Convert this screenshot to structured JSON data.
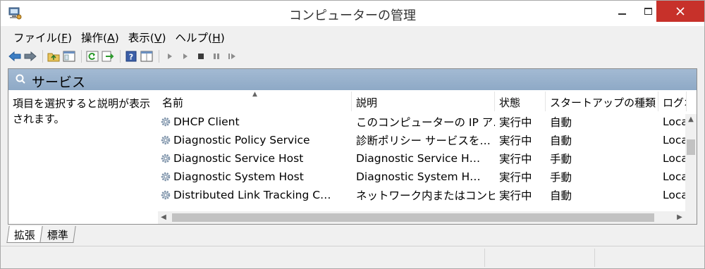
{
  "window": {
    "title": "コンピューターの管理"
  },
  "menu": [
    {
      "label": "ファイル(",
      "key": "F",
      "end": ")"
    },
    {
      "label": "操作(",
      "key": "A",
      "end": ")"
    },
    {
      "label": "表示(",
      "key": "V",
      "end": ")"
    },
    {
      "label": "ヘルプ(",
      "key": "H",
      "end": ")"
    }
  ],
  "toolbar": {
    "icons": [
      "back-icon",
      "forward-icon",
      "up-folder-icon",
      "show-hide-tree-icon",
      "refresh-icon",
      "export-list-icon",
      "help-icon",
      "properties-view-icon",
      "start-service-icon",
      "start-service-alt-icon",
      "stop-service-icon",
      "pause-service-icon",
      "resume-service-icon"
    ]
  },
  "panel": {
    "title": "サービス",
    "description_line1": "項目を選択すると説明が表示",
    "description_line2": "されます。"
  },
  "table": {
    "columns": [
      "名前",
      "説明",
      "状態",
      "スタートアップの種類",
      "ログオ"
    ],
    "rows": [
      {
        "name": "DHCP Client",
        "desc": "このコンピューターの IP ア…",
        "status": "実行中",
        "startup": "自動",
        "logon": "Local"
      },
      {
        "name": "Diagnostic Policy Service",
        "desc": "診断ポリシー サービスを…",
        "status": "実行中",
        "startup": "自動",
        "logon": "Local"
      },
      {
        "name": "Diagnostic Service Host",
        "desc": "Diagnostic Service H…",
        "status": "実行中",
        "startup": "手動",
        "logon": "Local"
      },
      {
        "name": "Diagnostic System Host",
        "desc": "Diagnostic System H…",
        "status": "実行中",
        "startup": "手動",
        "logon": "Local"
      },
      {
        "name": "Distributed Link Tracking C…",
        "desc": "ネットワーク内またはコンピ…",
        "status": "実行中",
        "startup": "自動",
        "logon": "Local"
      }
    ]
  },
  "tabs": [
    "拡張",
    "標準"
  ],
  "colors": {
    "header_band": "#9db4cd",
    "close_button": "#c7312a",
    "gear": "#7a8fa6"
  }
}
